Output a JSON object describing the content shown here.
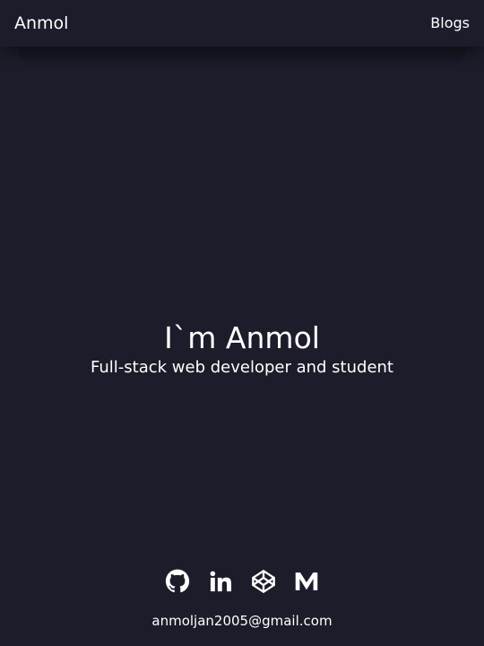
{
  "nav": {
    "brand": "Anmol",
    "links": [
      {
        "label": "Blogs"
      }
    ]
  },
  "hero": {
    "title": "I`m Anmol",
    "subtitle": "Full-stack web developer and student"
  },
  "socials": [
    {
      "name": "github",
      "icon": "github-icon"
    },
    {
      "name": "linkedin",
      "icon": "linkedin-icon"
    },
    {
      "name": "codepen",
      "icon": "codepen-icon"
    },
    {
      "name": "medium",
      "icon": "medium-icon"
    }
  ],
  "contact": {
    "email": "anmoljan2005@gmail.com"
  },
  "colors": {
    "background": "#1c1c2a",
    "text": "#ffffff"
  }
}
